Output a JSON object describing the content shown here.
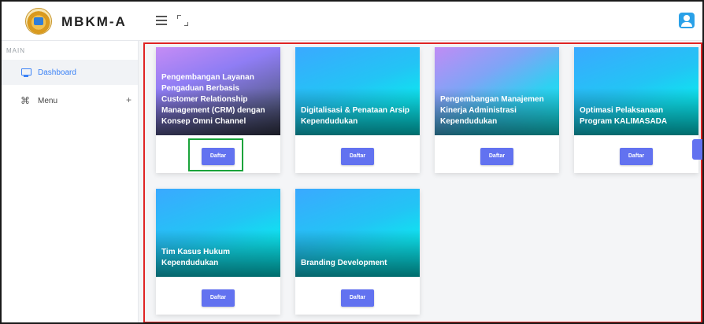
{
  "app": {
    "brand_name": "MBKM-A"
  },
  "sidebar": {
    "section_label": "MAIN",
    "items": [
      {
        "label": "Dashboard",
        "icon": "monitor-icon",
        "active": true
      },
      {
        "label": "Menu",
        "icon": "command-icon",
        "expand_symbol": "+"
      }
    ]
  },
  "cards": [
    {
      "title": "Pengembangan Layanan Pengaduan Berbasis Customer Relationship Management (CRM) dengan Konsep Omni Channel",
      "button_label": "Daftar"
    },
    {
      "title": "Digitalisasi & Penataan Arsip Kependudukan",
      "button_label": "Daftar"
    },
    {
      "title": "Pengembangan Manajemen Kinerja Administrasi Kependudukan",
      "button_label": "Daftar"
    },
    {
      "title": "Optimasi Pelaksanaan Program KALIMASADA",
      "button_label": "Daftar"
    },
    {
      "title": "Tim Kasus Hukum Kependudukan",
      "button_label": "Daftar"
    },
    {
      "title": "Branding Development",
      "button_label": "Daftar"
    }
  ],
  "colors": {
    "accent": "#6272f0",
    "active_link": "#3b82f6",
    "highlight_red": "#e02424",
    "highlight_green": "#1aa33a"
  }
}
